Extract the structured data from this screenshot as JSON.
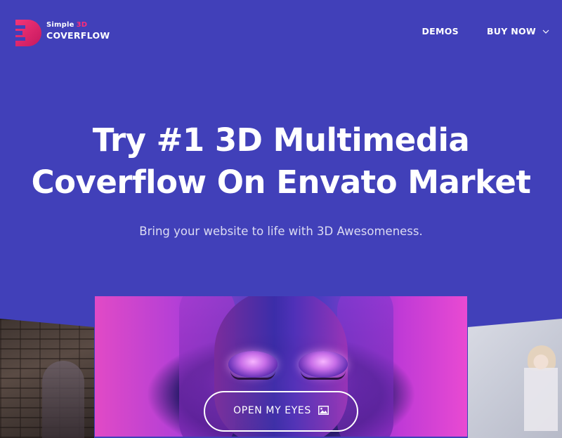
{
  "brand": {
    "line1_prefix": "Simple",
    "line1_accent": "3D",
    "line2": "COVERFLOW",
    "accent_color": "#ff2b7a"
  },
  "nav": {
    "items": [
      {
        "label": "DEMOS"
      },
      {
        "label": "BUY NOW",
        "icon": "chevron-down-icon"
      }
    ]
  },
  "hero": {
    "title_line1": "Try #1 3D Multimedia",
    "title_line2": "Coverflow On Envato Market",
    "subtitle": "Bring your website to life with 3D Awesomeness."
  },
  "cta": {
    "label": "OPEN MY EYES",
    "icon": "image-icon"
  },
  "colors": {
    "background": "#4140b9",
    "text": "#ffffff"
  }
}
